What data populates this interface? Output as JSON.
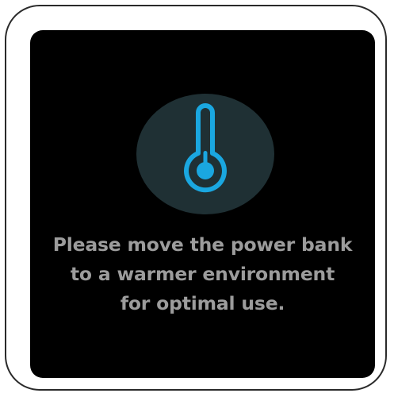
{
  "alert": {
    "icon": "thermometer-icon",
    "message_lines": [
      "Please move the power bank",
      "to a warmer environment",
      "for optimal use."
    ]
  },
  "colors": {
    "screen_background": "#000000",
    "icon_circle": "#1f3034",
    "icon_accent": "#1aa7e0",
    "message_text": "#9c9c9c"
  }
}
